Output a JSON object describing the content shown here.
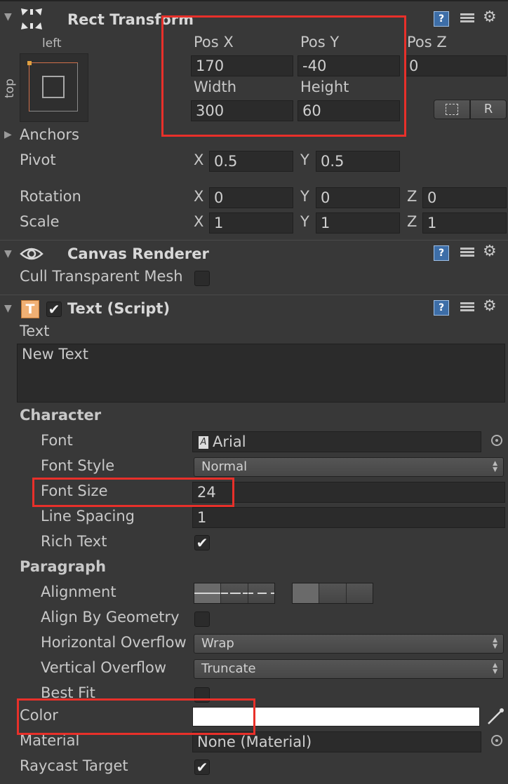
{
  "rect_transform": {
    "title": "Rect Transform",
    "anchor_left": "left",
    "anchor_top": "top",
    "pos_x_label": "Pos X",
    "pos_y_label": "Pos Y",
    "pos_z_label": "Pos Z",
    "pos_x": "170",
    "pos_y": "-40",
    "pos_z": "0",
    "width_label": "Width",
    "height_label": "Height",
    "width": "300",
    "height": "60",
    "r_button": "R",
    "anchors_label": "Anchors",
    "pivot_label": "Pivot",
    "pivot_x": "0.5",
    "pivot_y": "0.5",
    "rotation_label": "Rotation",
    "rotation_x": "0",
    "rotation_y": "0",
    "rotation_z": "0",
    "scale_label": "Scale",
    "scale_x": "1",
    "scale_y": "1",
    "scale_z": "1",
    "axis_x": "X",
    "axis_y": "Y",
    "axis_z": "Z"
  },
  "canvas_renderer": {
    "title": "Canvas Renderer",
    "cull_label": "Cull Transparent Mesh",
    "cull_checked": false
  },
  "text_script": {
    "title": "Text (Script)",
    "icon_letter": "T",
    "text_label": "Text",
    "text_value": "New Text",
    "character_label": "Character",
    "font_label": "Font",
    "font_value": "Arial",
    "font_style_label": "Font Style",
    "font_style_value": "Normal",
    "font_size_label": "Font Size",
    "font_size_value": "24",
    "line_spacing_label": "Line Spacing",
    "line_spacing_value": "1",
    "rich_text_label": "Rich Text",
    "paragraph_label": "Paragraph",
    "alignment_label": "Alignment",
    "align_by_geometry_label": "Align By Geometry",
    "h_overflow_label": "Horizontal Overflow",
    "h_overflow_value": "Wrap",
    "v_overflow_label": "Vertical Overflow",
    "v_overflow_value": "Truncate",
    "best_fit_label": "Best Fit",
    "color_label": "Color",
    "color_value": "#ffffff",
    "material_label": "Material",
    "material_value": "None (Material)",
    "raycast_label": "Raycast Target"
  },
  "colors": {
    "highlight": "#e8302a",
    "panel": "#383838",
    "field": "#2b2b2b"
  }
}
